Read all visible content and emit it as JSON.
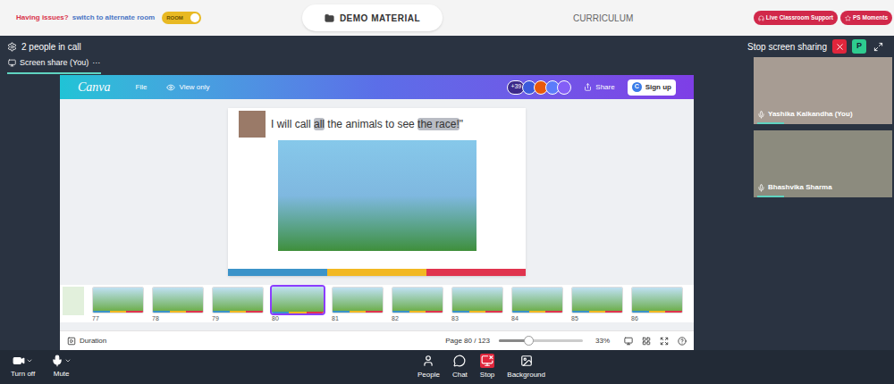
{
  "topbar": {
    "issue_text": "Having issues?",
    "switch_link": "switch to alternate room",
    "room_toggle": {
      "label": "ROOM",
      "on": true
    },
    "demo_button": "DEMO MATERIAL",
    "curriculum": "CURRICULUM",
    "pills": [
      "Live Classroom Support",
      "PS Moments"
    ]
  },
  "call": {
    "people_count": "2 people in call",
    "stop_sharing": "Stop screen sharing",
    "avatar": "P",
    "tab": {
      "label": "Screen share (You)",
      "more": "···",
      "selected": true
    }
  },
  "canva": {
    "logo": "Canva",
    "menu": [
      "File"
    ],
    "view_mode": "View only",
    "collaborators_count": "+39",
    "share": "Share",
    "signup_icon": "C",
    "signup": "Sign up",
    "slide": {
      "segments": [
        {
          "text": "I will call ",
          "highlighted": false
        },
        {
          "text": "all",
          "highlighted": true
        },
        {
          "text": " the animals to see ",
          "highlighted": false
        },
        {
          "text": "the race!",
          "highlighted": true
        },
        {
          "text": "\"",
          "highlighted": false
        }
      ]
    },
    "thumbnails": [
      {
        "number": "77",
        "selected": false
      },
      {
        "number": "78",
        "selected": false
      },
      {
        "number": "79",
        "selected": false
      },
      {
        "number": "80",
        "selected": true
      },
      {
        "number": "81",
        "selected": false
      },
      {
        "number": "82",
        "selected": false
      },
      {
        "number": "83",
        "selected": false
      },
      {
        "number": "84",
        "selected": false
      },
      {
        "number": "85",
        "selected": false
      },
      {
        "number": "86",
        "selected": false
      }
    ],
    "duration": "Duration",
    "page": "Page 80 / 123",
    "zoom": {
      "level": 0.35,
      "reading": "33%"
    }
  },
  "participants": [
    {
      "name": "Yashika Kalkandha (You)"
    },
    {
      "name": "Bhashvika Sharma"
    }
  ],
  "controls": {
    "left": [
      {
        "label": "Turn off"
      },
      {
        "label": "Mute"
      }
    ],
    "center": [
      {
        "label": "People",
        "kind": "normal"
      },
      {
        "label": "Chat",
        "kind": "normal"
      },
      {
        "label": "Stop",
        "kind": "danger"
      },
      {
        "label": "Background",
        "kind": "normal"
      }
    ]
  }
}
